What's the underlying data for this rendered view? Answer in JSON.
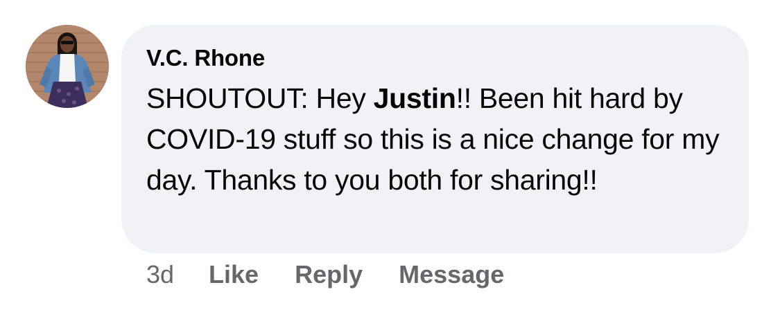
{
  "comment": {
    "author": "V.C. Rhone",
    "text_before": "SHOUTOUT: Hey ",
    "mention": "Justin",
    "text_after": "!! Been hit hard by COVID-19 stuff so this is a nice change for my day. Thanks to you both for sharing!!",
    "bubble_color": "#f0f2f5"
  },
  "actions": {
    "time": "3d",
    "like": "Like",
    "reply": "Reply",
    "message": "Message",
    "color": "#65676b"
  },
  "avatar": {
    "icon": "profile-photo"
  }
}
